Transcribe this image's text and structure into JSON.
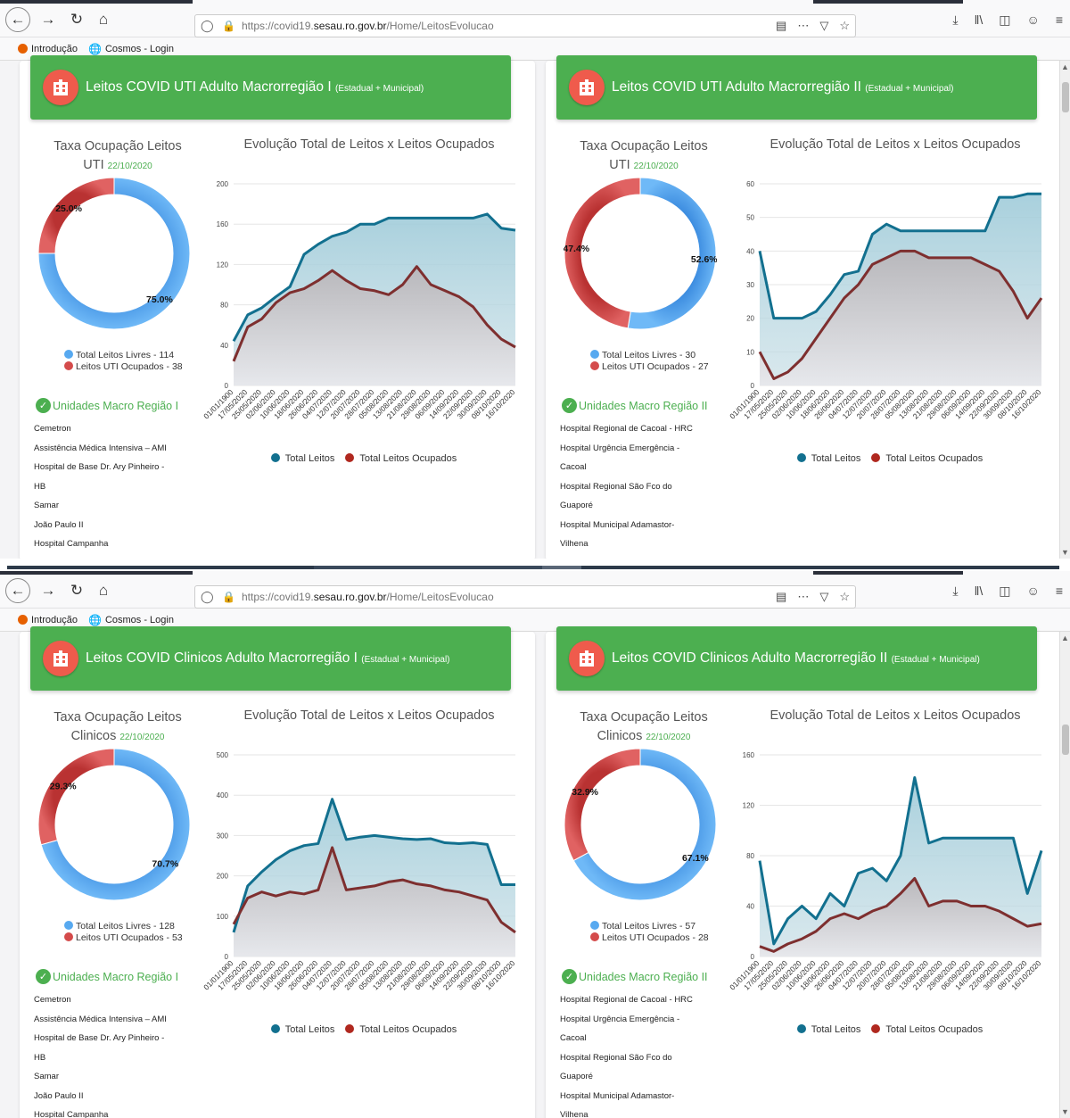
{
  "browser": {
    "url_prefix": "https://covid19.",
    "url_domain": "sesau.ro.gov.br",
    "url_path": "/Home/LeitosEvolucao",
    "bookmarks": [
      "Introdução",
      "Cosmos - Login"
    ],
    "nav_icons": [
      "back-icon",
      "forward-icon",
      "reload-icon",
      "home-icon"
    ],
    "url_icons": [
      "reader-view-icon",
      "more-icon",
      "pocket-icon",
      "bookmark-star-icon"
    ],
    "toolbar_icons": [
      "download-icon",
      "library-icon",
      "sidebar-icon",
      "account-icon",
      "menu-icon"
    ]
  },
  "colors": {
    "header_green": "#4caf50",
    "free_blue": "#57a9f0",
    "occupied_red": "#d44b4b",
    "total_line": "#12708f",
    "occupied_line": "#7e2f2f"
  },
  "common": {
    "occupancy_label": "Taxa Ocupação Leitos",
    "chart_title": "Evolução Total de Leitos x Leitos Ocupados",
    "legend_total": "Total Leitos",
    "legend_occupied": "Total Leitos Ocupados",
    "header_suffix": "(Estadual + Municipal)"
  },
  "screens": [
    {
      "panels": [
        {
          "title": "Leitos COVID UTI Adulto Macrorregião I",
          "bed_type": "UTI",
          "date": "22/10/2020",
          "free_pct": "75.0%",
          "occupied_pct": "25.0%",
          "free_fraction": 0.75,
          "legend_free": "Total Leitos Livres - 114",
          "legend_occupied": "Leitos UTI Ocupados - 38",
          "units_title": "Unidades Macro Região I",
          "units": [
            "Cemetron",
            "Assistência Médica Intensiva – AMI",
            "Hospital de Base Dr. Ary Pinheiro -",
            "HB",
            "Samar",
            "João Paulo II",
            "Hospital Campanha"
          ]
        },
        {
          "title": "Leitos COVID UTI Adulto Macrorregião II",
          "bed_type": "UTI",
          "date": "22/10/2020",
          "free_pct": "52.6%",
          "occupied_pct": "47.4%",
          "free_fraction": 0.526,
          "legend_free": "Total Leitos Livres - 30",
          "legend_occupied": "Leitos UTI Ocupados - 27",
          "units_title": "Unidades Macro Região II",
          "units": [
            "Hospital Regional de Cacoal - HRC",
            "Hospital Urgência Emergência -",
            "Cacoal",
            "Hospital Regional São Fco do",
            "Guaporé",
            "Hospital Municipal Adamastor-",
            "Vilhena"
          ]
        }
      ]
    },
    {
      "panels": [
        {
          "title": "Leitos COVID Clinicos Adulto Macrorregião I",
          "bed_type": "Clinicos",
          "date": "22/10/2020",
          "free_pct": "70.7%",
          "occupied_pct": "29.3%",
          "free_fraction": 0.707,
          "legend_free": "Total Leitos Livres - 128",
          "legend_occupied": "Leitos UTI Ocupados - 53",
          "units_title": "Unidades Macro Região I",
          "units": [
            "Cemetron",
            "Assistência Médica Intensiva – AMI",
            "Hospital de Base Dr. Ary Pinheiro -",
            "HB",
            "Samar",
            "João Paulo II",
            "Hospital Campanha"
          ]
        },
        {
          "title": "Leitos COVID Clinicos Adulto Macrorregião II",
          "bed_type": "Clinicos",
          "date": "22/10/2020",
          "free_pct": "67.1%",
          "occupied_pct": "32.9%",
          "free_fraction": 0.671,
          "legend_free": "Total Leitos Livres - 57",
          "legend_occupied": "Leitos UTI Ocupados - 28",
          "units_title": "Unidades Macro Região II",
          "units": [
            "Hospital Regional de Cacoal - HRC",
            "Hospital Urgência Emergência -",
            "Cacoal",
            "Hospital Regional São Fco do",
            "Guaporé",
            "Hospital Municipal Adamastor-",
            "Vilhena"
          ]
        }
      ]
    }
  ],
  "chart_data": [
    {
      "type": "area",
      "title": "Evolução Total de Leitos x Leitos Ocupados",
      "x_labels": [
        "01/01/1900",
        "17/05/2020",
        "25/05/2020",
        "02/06/2020",
        "10/06/2020",
        "18/06/2020",
        "26/06/2020",
        "04/07/2020",
        "12/07/2020",
        "20/07/2020",
        "28/07/2020",
        "05/08/2020",
        "13/08/2020",
        "21/08/2020",
        "29/08/2020",
        "06/09/2020",
        "14/09/2020",
        "22/09/2020",
        "30/09/2020",
        "08/10/2020",
        "16/10/2020"
      ],
      "ylim": [
        0,
        200
      ],
      "yticks": [
        0,
        40,
        80,
        120,
        160,
        200
      ],
      "series": [
        {
          "name": "Total Leitos",
          "values": [
            44,
            70,
            77,
            88,
            98,
            130,
            140,
            148,
            152,
            160,
            160,
            166,
            166,
            166,
            166,
            166,
            166,
            166,
            170,
            156,
            154
          ]
        },
        {
          "name": "Total Leitos Ocupados",
          "values": [
            24,
            58,
            66,
            82,
            92,
            96,
            104,
            114,
            104,
            96,
            94,
            90,
            100,
            118,
            100,
            94,
            88,
            78,
            60,
            46,
            38
          ]
        }
      ]
    },
    {
      "type": "area",
      "title": "Evolução Total de Leitos x Leitos Ocupados",
      "x_labels": [
        "01/01/1900",
        "17/05/2020",
        "25/05/2020",
        "02/06/2020",
        "10/06/2020",
        "18/06/2020",
        "26/06/2020",
        "04/07/2020",
        "12/07/2020",
        "20/07/2020",
        "28/07/2020",
        "05/08/2020",
        "13/08/2020",
        "21/08/2020",
        "29/08/2020",
        "06/09/2020",
        "14/09/2020",
        "22/09/2020",
        "30/09/2020",
        "08/10/2020",
        "16/10/2020"
      ],
      "ylim": [
        0,
        60
      ],
      "yticks": [
        0,
        10,
        20,
        30,
        40,
        50,
        60
      ],
      "series": [
        {
          "name": "Total Leitos",
          "values": [
            40,
            20,
            20,
            20,
            22,
            27,
            33,
            34,
            45,
            48,
            46,
            46,
            46,
            46,
            46,
            46,
            46,
            56,
            56,
            57,
            57
          ]
        },
        {
          "name": "Total Leitos Ocupados",
          "values": [
            10,
            2,
            4,
            8,
            14,
            20,
            26,
            30,
            36,
            38,
            40,
            40,
            38,
            38,
            38,
            38,
            36,
            34,
            28,
            20,
            26
          ]
        }
      ]
    },
    {
      "type": "area",
      "title": "Evolução Total de Leitos x Leitos Ocupados",
      "x_labels": [
        "01/01/1900",
        "17/05/2020",
        "25/05/2020",
        "02/06/2020",
        "10/06/2020",
        "18/06/2020",
        "26/06/2020",
        "04/07/2020",
        "12/07/2020",
        "20/07/2020",
        "28/07/2020",
        "05/08/2020",
        "13/08/2020",
        "21/08/2020",
        "29/08/2020",
        "06/09/2020",
        "14/09/2020",
        "22/09/2020",
        "30/09/2020",
        "08/10/2020",
        "16/10/2020"
      ],
      "ylim": [
        0,
        500
      ],
      "yticks": [
        0,
        100,
        200,
        300,
        400,
        500
      ],
      "series": [
        {
          "name": "Total Leitos",
          "values": [
            60,
            175,
            210,
            240,
            262,
            275,
            280,
            390,
            290,
            296,
            300,
            296,
            292,
            290,
            292,
            282,
            280,
            282,
            278,
            178,
            178
          ]
        },
        {
          "name": "Total Leitos Ocupados",
          "values": [
            80,
            145,
            160,
            150,
            160,
            155,
            165,
            270,
            165,
            170,
            175,
            185,
            190,
            180,
            175,
            165,
            160,
            150,
            140,
            85,
            60
          ]
        }
      ]
    },
    {
      "type": "area",
      "title": "Evolução Total de Leitos x Leitos Ocupados",
      "x_labels": [
        "01/01/1900",
        "17/05/2020",
        "25/05/2020",
        "02/06/2020",
        "10/06/2020",
        "18/06/2020",
        "26/06/2020",
        "04/07/2020",
        "12/07/2020",
        "20/07/2020",
        "28/07/2020",
        "05/08/2020",
        "13/08/2020",
        "21/08/2020",
        "29/08/2020",
        "06/09/2020",
        "14/09/2020",
        "22/09/2020",
        "30/09/2020",
        "08/10/2020",
        "16/10/2020"
      ],
      "ylim": [
        0,
        160
      ],
      "yticks": [
        0,
        40,
        80,
        120,
        160
      ],
      "series": [
        {
          "name": "Total Leitos",
          "values": [
            76,
            10,
            30,
            40,
            30,
            50,
            40,
            66,
            70,
            60,
            80,
            142,
            90,
            94,
            94,
            94,
            94,
            94,
            94,
            50,
            84
          ]
        },
        {
          "name": "Total Leitos Ocupados",
          "values": [
            8,
            4,
            10,
            14,
            20,
            30,
            34,
            30,
            36,
            40,
            50,
            62,
            40,
            44,
            44,
            40,
            40,
            36,
            30,
            24,
            26
          ]
        }
      ]
    }
  ]
}
